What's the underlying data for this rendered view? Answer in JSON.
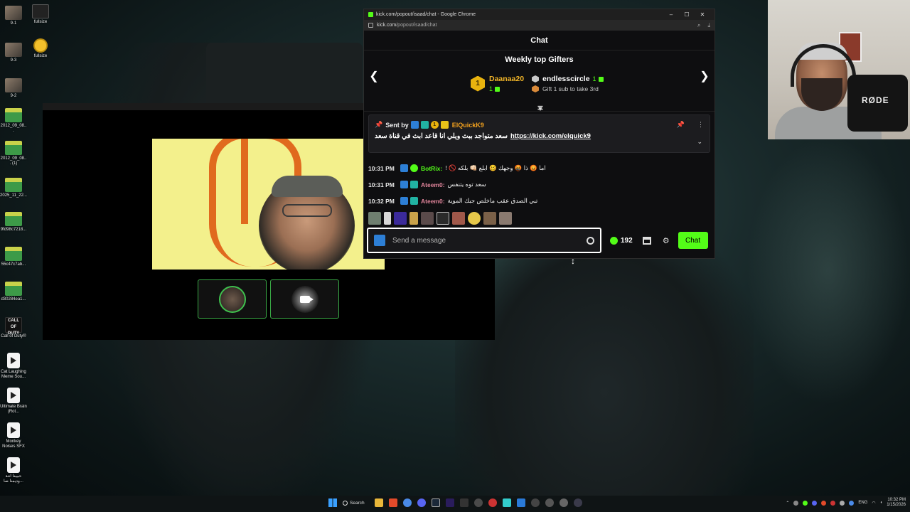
{
  "desktop": {
    "icons": [
      {
        "label": "9-1",
        "kind": "pic"
      },
      {
        "label": "fullsize",
        "kind": "face"
      },
      {
        "label": "9-3",
        "kind": "pic"
      },
      {
        "label": "fullsize",
        "kind": "emoji"
      },
      {
        "label": "9-2",
        "kind": "pic"
      },
      {
        "label": "2012_09_08...",
        "kind": "pepe"
      },
      {
        "label": "2012_09_08... (1)",
        "kind": "pepe"
      },
      {
        "label": "2025_11_22...",
        "kind": "pepe"
      },
      {
        "label": "9fd98c7218...",
        "kind": "pepe"
      },
      {
        "label": "55c47c7ab...",
        "kind": "pepe"
      },
      {
        "label": "d30284ea1...",
        "kind": "pepe"
      },
      {
        "label": "Call of Duty®",
        "kind": "cod"
      },
      {
        "label": "Cat Laughing Meme Sou...",
        "kind": "media"
      },
      {
        "label": "Ultimate Brain (Rot...",
        "kind": "media"
      },
      {
        "label": "Monkey Noises SFX",
        "kind": "media"
      },
      {
        "label": "حبيبنا انتة وديمنا صا...",
        "kind": "media"
      }
    ]
  },
  "webcam": {
    "mic_brand": "RØDE"
  },
  "browser": {
    "window_title": "kick.com/popout/isaad/chat - Google Chrome",
    "url_host": "kick.com",
    "url_path": "/popout/isaad/chat",
    "controls": {
      "minimize": "–",
      "maximize": "☐",
      "close": "✕"
    }
  },
  "chat": {
    "header": "Chat",
    "gifters": {
      "title": "Weekly top Gifters",
      "first": {
        "rank": "1",
        "name": "Daanaa20",
        "count": "1"
      },
      "second": {
        "name": "endlesscircle",
        "count": "1",
        "hint": "Gift 1 sub to take 3rd"
      }
    },
    "pinned": {
      "sent_by": "Sent by",
      "user": "ElQuickK9",
      "badge_number": "1",
      "text": "سعد متواجد ببث ويلي انا قاعد ابث في قناة سعد",
      "link": "https://kick.com/elquick9"
    },
    "messages": [
      {
        "time": "10:31 PM",
        "user": "BotRix:",
        "user_color": "#53fc18",
        "text": "اما 😡 ذا 🤬 وجهك 🥴 ابلع 👊🏻 بلكه 🚫 !"
      },
      {
        "time": "10:31 PM",
        "user": "Ateem0:",
        "user_color": "#e0849a",
        "text": "سعد توه يتنفس"
      },
      {
        "time": "10:32 PM",
        "user": "Ateem0:",
        "user_color": "#e0849a",
        "text": "تبي الصدق عقب ماخلص جبك الموية"
      }
    ],
    "input": {
      "placeholder": "Send a message",
      "value": ""
    },
    "points": "192",
    "send_label": "Chat"
  },
  "taskbar": {
    "search_label": "Search",
    "language": "ENG",
    "time": "10:32 PM",
    "date": "1/15/2026"
  },
  "colors": {
    "kick_green": "#53fc18",
    "gold": "#f0b428",
    "pinned_user": "#f4a21e",
    "ateem_pink": "#e0849a"
  }
}
